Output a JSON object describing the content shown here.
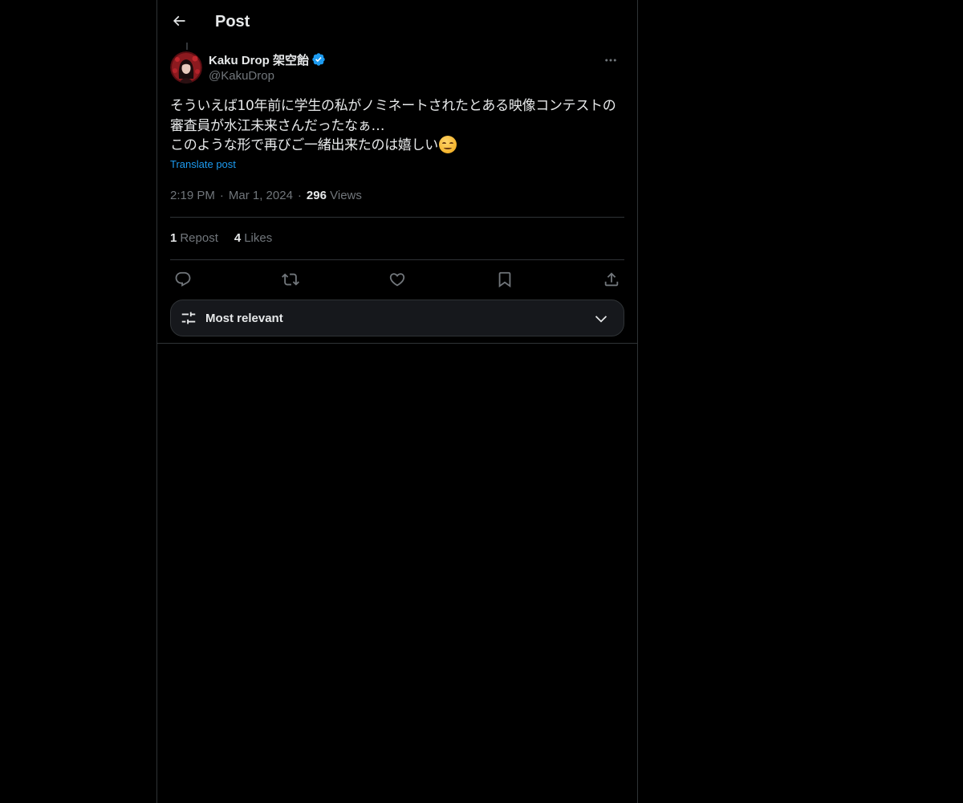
{
  "header": {
    "title": "Post"
  },
  "author": {
    "display_name": "Kaku Drop 架空飴",
    "handle": "@KakuDrop",
    "verified": true
  },
  "post": {
    "lines": [
      "そういえば10年前に学生の私がノミネートされたとある映像コンテストの",
      "審査員が水江未来さんだったなぁ…",
      "このような形で再びご一緒出来たのは嬉しい"
    ],
    "emoji": "smiling-face-with-blush",
    "translate_label": "Translate post"
  },
  "meta": {
    "time": "2:19 PM",
    "date": "Mar 1, 2024",
    "views_count": "296",
    "views_label": "Views"
  },
  "stats": {
    "reposts_count": "1",
    "reposts_label": "Repost",
    "likes_count": "4",
    "likes_label": "Likes"
  },
  "actions": [
    "reply-icon",
    "repost-icon",
    "like-icon",
    "bookmark-icon",
    "share-icon"
  ],
  "replies_sort": {
    "label": "Most relevant"
  },
  "colors": {
    "background": "#000000",
    "text": "#e7e9ea",
    "muted": "#71767b",
    "accent": "#1d9bf0",
    "border": "#2f3336"
  }
}
